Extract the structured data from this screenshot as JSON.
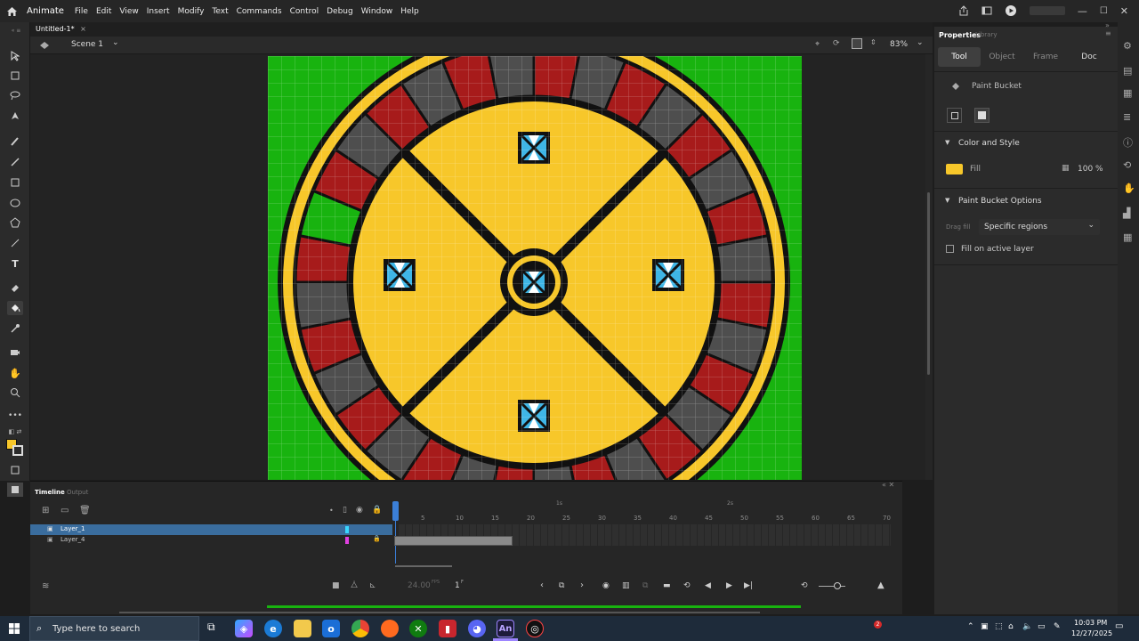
{
  "app": {
    "name": "Animate"
  },
  "menu": [
    "File",
    "Edit",
    "View",
    "Insert",
    "Modify",
    "Text",
    "Commands",
    "Control",
    "Debug",
    "Window",
    "Help"
  ],
  "document": {
    "tab_title": "Untitled-1*",
    "scene": "Scene 1",
    "zoom": "83%"
  },
  "properties": {
    "panel_tabs": [
      "Properties",
      "Library"
    ],
    "tool_tabs": [
      "Tool",
      "Object",
      "Frame",
      "Doc"
    ],
    "tool_name": "Paint Bucket",
    "color_section": "Color and Style",
    "fill_label": "Fill",
    "fill_color": "#f7c72a",
    "fill_opacity": "100 %",
    "options_section": "Paint Bucket Options",
    "drag_fill_label": "Drag fill",
    "drag_fill_value": "Specific regions",
    "active_layer_label": "Fill on active layer"
  },
  "timeline": {
    "tabs": [
      "Timeline",
      "Output"
    ],
    "layers": [
      {
        "name": "Layer_1",
        "selected": true,
        "color": "#39d7ff"
      },
      {
        "name": "Layer_4",
        "selected": false,
        "color": "#e040e0"
      }
    ],
    "fps": "24.00",
    "fps_unit": "FPS",
    "frame": "1",
    "frame_unit": "F",
    "ruler_numbers": [
      "5",
      "10",
      "15",
      "20",
      "25",
      "30",
      "35",
      "40",
      "45",
      "50",
      "55",
      "60",
      "65",
      "70"
    ],
    "second_marks": [
      "1s",
      "2s"
    ]
  },
  "taskbar": {
    "search_placeholder": "Type here to search",
    "time": "10:03 PM",
    "date": "12/27/2025",
    "notification_count": "2"
  },
  "colors": {
    "stage_green": "#18b30f",
    "wheel_yellow": "#f7c72a",
    "pocket_red": "#a71b1b",
    "pocket_gray": "#4e4e4e",
    "gem_blue": "#3fb6e6"
  }
}
